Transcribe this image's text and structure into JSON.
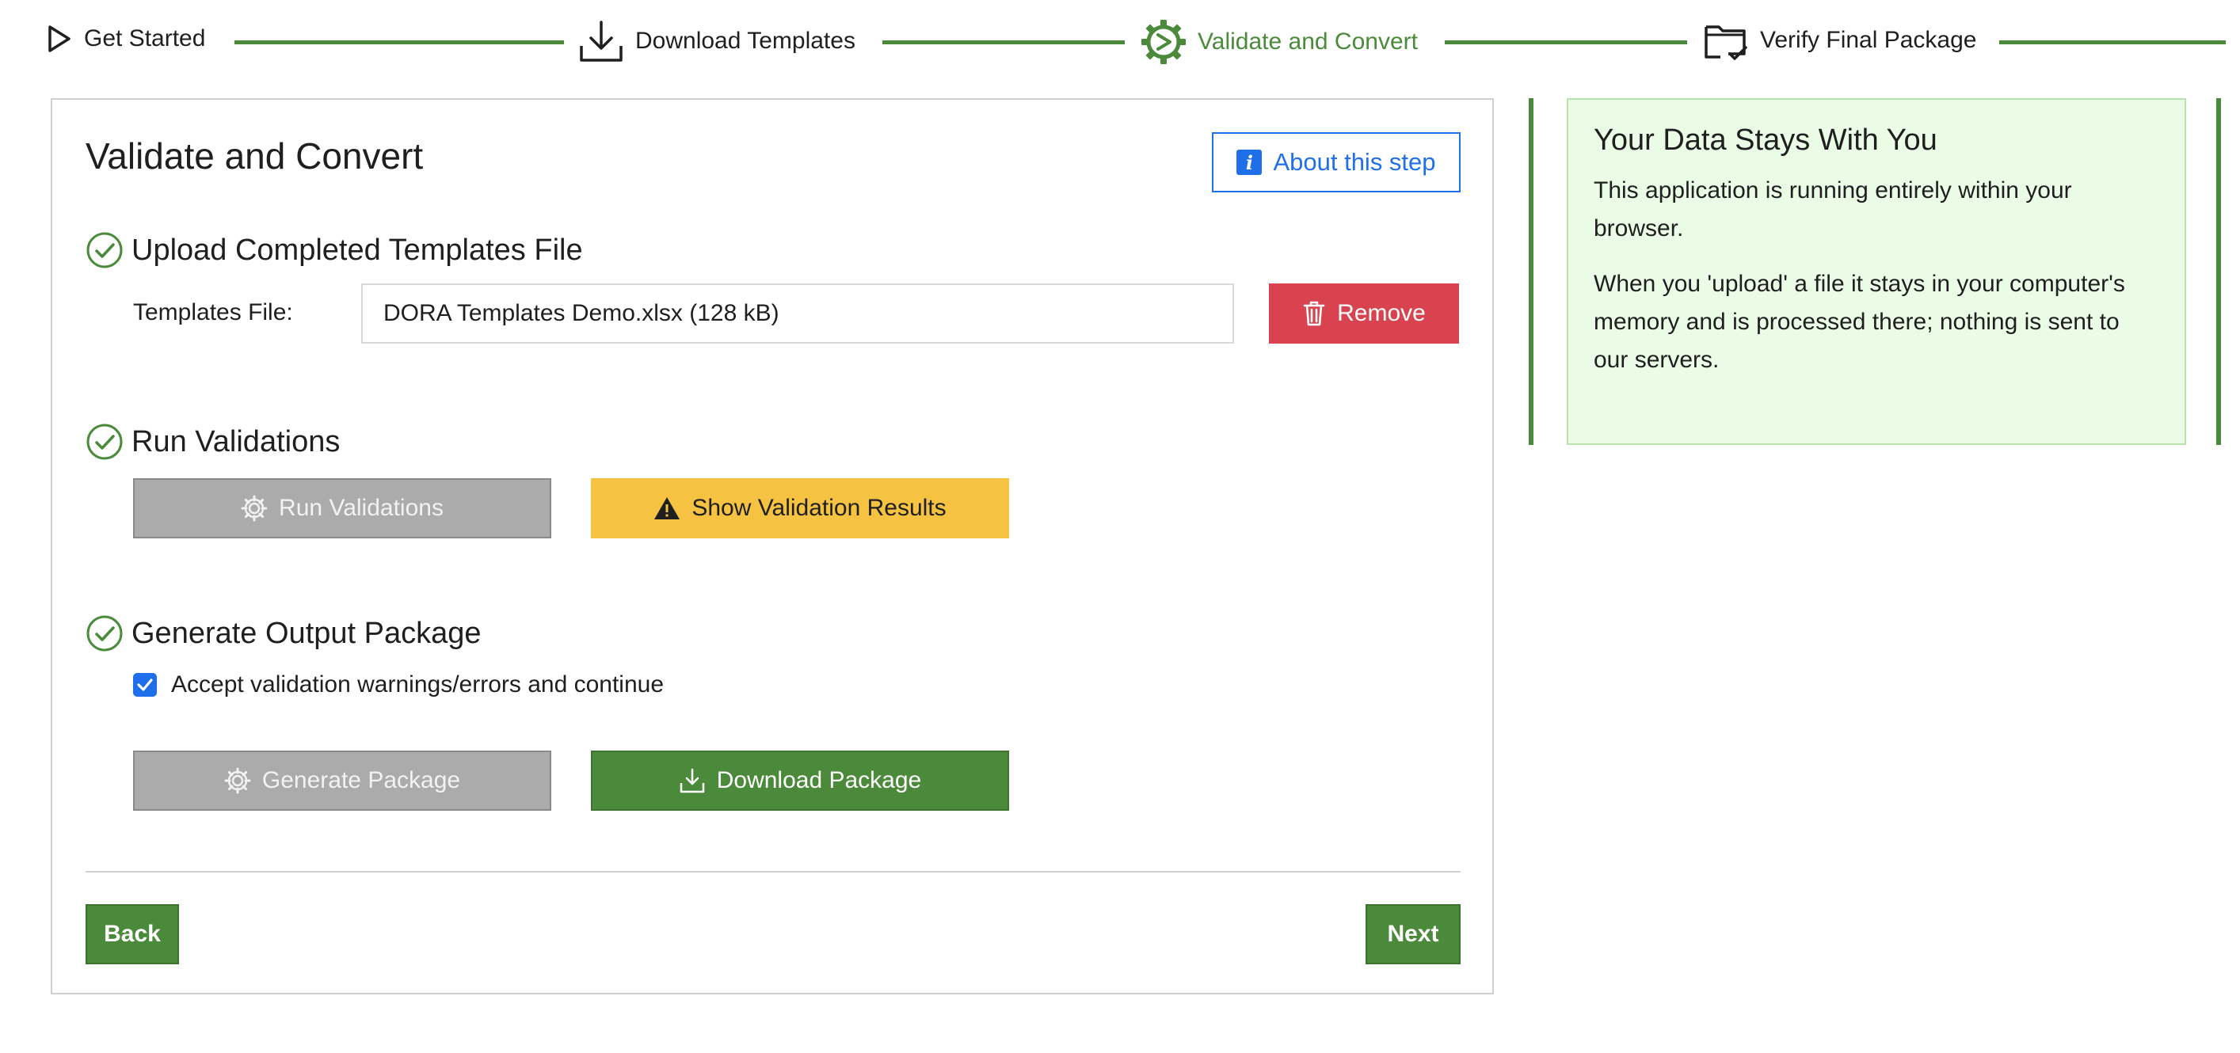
{
  "stepper": {
    "steps": [
      {
        "label": "Get Started",
        "icon": "play-outline-icon",
        "state": "done"
      },
      {
        "label": "Download Templates",
        "icon": "download-icon",
        "state": "done"
      },
      {
        "label": "Validate and Convert",
        "icon": "gear-convert-icon",
        "state": "active"
      },
      {
        "label": "Verify Final Package",
        "icon": "folder-check-icon",
        "state": "pending"
      }
    ],
    "accent_color": "#4a8a3a"
  },
  "main": {
    "title": "Validate and Convert",
    "about_label": "About this step",
    "upload": {
      "heading": "Upload Completed Templates File",
      "field_label": "Templates File:",
      "file_value": "DORA Templates Demo.xlsx (128 kB)",
      "remove_label": "Remove"
    },
    "validations": {
      "heading": "Run Validations",
      "run_label": "Run Validations",
      "show_label": "Show Validation Results"
    },
    "output": {
      "heading": "Generate Output Package",
      "checkbox_label": "Accept validation warnings/errors and continue",
      "checkbox_checked": true,
      "generate_label": "Generate Package",
      "download_label": "Download Package"
    },
    "back_label": "Back",
    "next_label": "Next"
  },
  "side": {
    "heading": "Your Data Stays With You",
    "p1": "This application is running entirely within your browser.",
    "p2": "When you 'upload' a file it stays in your computer's memory and is processed there; nothing is sent to our servers."
  }
}
